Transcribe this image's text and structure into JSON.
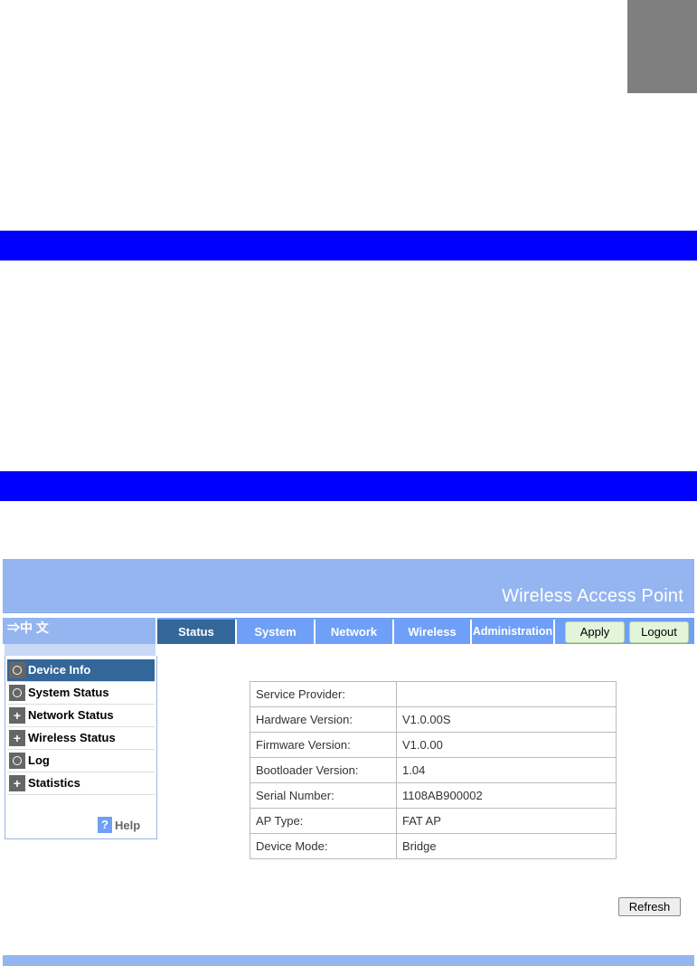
{
  "banner": {
    "title": "Wireless Access Point"
  },
  "language": {
    "label": "⇒中 文"
  },
  "tabs": [
    {
      "label": "Status",
      "active": true
    },
    {
      "label": "System",
      "active": false
    },
    {
      "label": "Network",
      "active": false
    },
    {
      "label": "Wireless",
      "active": false
    },
    {
      "label": "Administration",
      "active": false
    }
  ],
  "actions": {
    "apply_label": "Apply",
    "logout_label": "Logout"
  },
  "sidebar": {
    "items": [
      {
        "label": "Device Info",
        "icon": "circle-icon",
        "active": true
      },
      {
        "label": "System Status",
        "icon": "circle-icon",
        "active": false
      },
      {
        "label": "Network Status",
        "icon": "plus-icon",
        "active": false
      },
      {
        "label": "Wireless Status",
        "icon": "plus-icon",
        "active": false
      },
      {
        "label": "Log",
        "icon": "circle-icon",
        "active": false
      },
      {
        "label": "Statistics",
        "icon": "plus-icon",
        "active": false
      }
    ],
    "help_label": "Help"
  },
  "device_info": {
    "rows": [
      {
        "label": "Service Provider:",
        "value": ""
      },
      {
        "label": "Hardware Version:",
        "value": "V1.0.00S"
      },
      {
        "label": "Firmware Version:",
        "value": "V1.0.00"
      },
      {
        "label": "Bootloader Version:",
        "value": "1.04"
      },
      {
        "label": "Serial Number:",
        "value": "1108AB900002"
      },
      {
        "label": "AP Type:",
        "value": "FAT AP"
      },
      {
        "label": "Device Mode:",
        "value": "Bridge"
      }
    ]
  },
  "refresh_label": "Refresh",
  "colors": {
    "band_blue": "#0000ff",
    "banner": "#94b5f0",
    "tab": "#6f9ff7",
    "tab_active": "#336699",
    "gray_tab": "#7f7f7f"
  }
}
